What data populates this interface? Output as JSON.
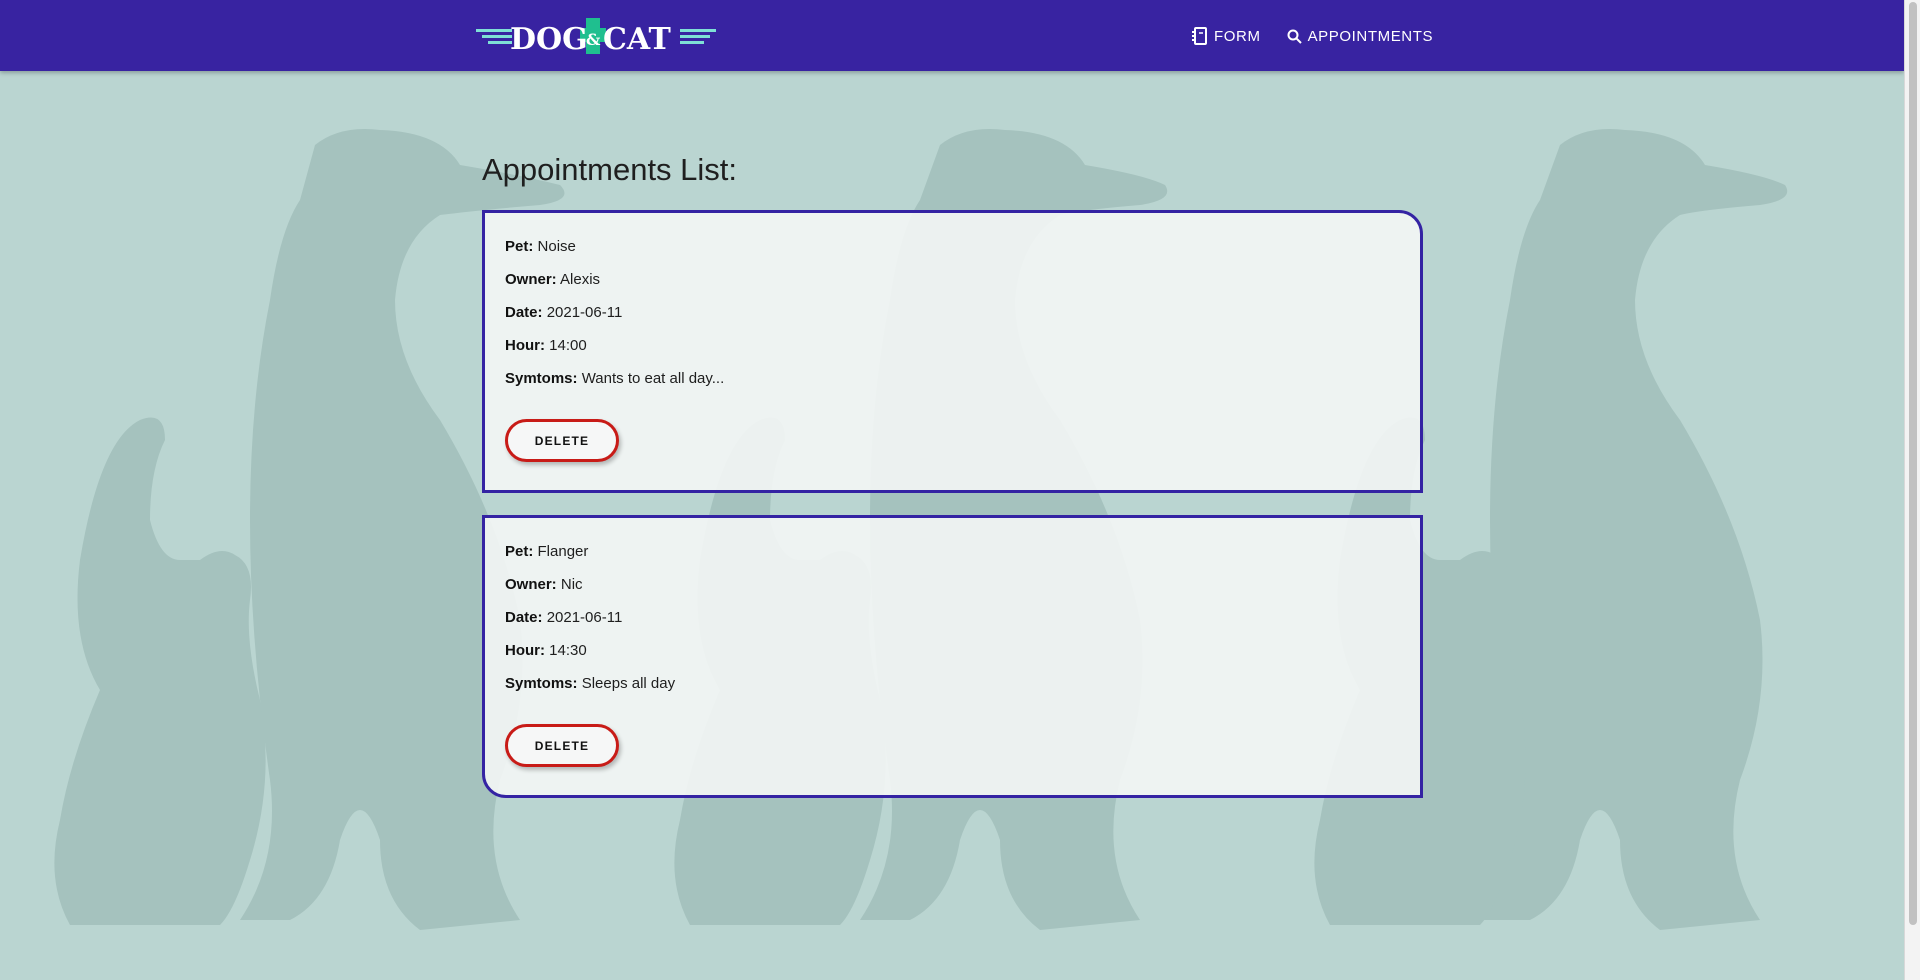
{
  "brand": {
    "logo_text": "DOG & CAT",
    "logo_left": "DOG",
    "logo_amp": "&",
    "logo_right": "CAT"
  },
  "nav": {
    "links": [
      {
        "label": "FORM",
        "icon": "notebook-icon"
      },
      {
        "label": "APPOINTMENTS",
        "icon": "search-icon"
      }
    ]
  },
  "main": {
    "title": "Appointments List:",
    "field_labels": {
      "pet": "Pet:",
      "owner": "Owner:",
      "date": "Date:",
      "hour": "Hour:",
      "symptoms": "Symtoms:"
    },
    "appointments": [
      {
        "pet": "Noise",
        "owner": "Alexis",
        "date": "2021-06-11",
        "hour": "14:00",
        "symptoms": "Wants to eat all day...",
        "delete_label": "DELETE"
      },
      {
        "pet": "Flanger",
        "owner": "Nic",
        "date": "2021-06-11",
        "hour": "14:30",
        "symptoms": "Sleeps all day",
        "delete_label": "DELETE"
      }
    ]
  },
  "colors": {
    "navbar": "#3823a1",
    "background": "#bad5d1",
    "card_border": "#3423a3",
    "delete_border": "#c81b17",
    "logo_cross": "#1fbf8f"
  }
}
